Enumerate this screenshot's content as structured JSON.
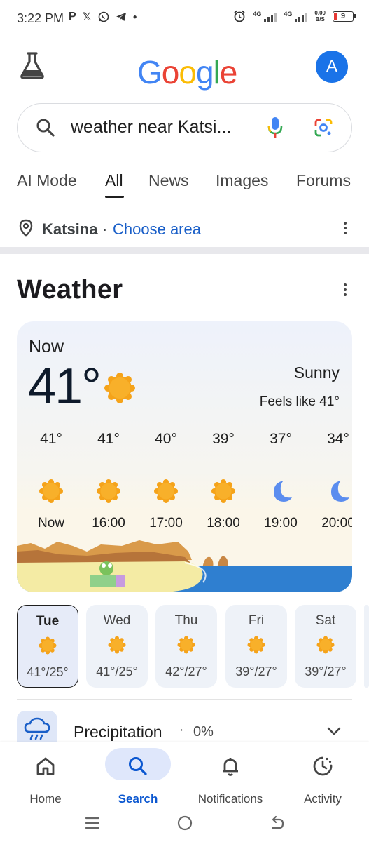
{
  "status_bar": {
    "time": "3:22 PM",
    "app_icons": [
      "P",
      "𝕏"
    ],
    "network_1": "4G",
    "network_2": "4G",
    "speed_value": "0.00",
    "speed_unit": "B/S",
    "battery": "9"
  },
  "header": {
    "logo": [
      "G",
      "o",
      "o",
      "g",
      "l",
      "e"
    ],
    "logo_colors": [
      "#4285F4",
      "#EA4335",
      "#FBBC05",
      "#4285F4",
      "#34A853",
      "#EA4335"
    ],
    "avatar_letter": "A",
    "avatar_color": "#1a73e8"
  },
  "search": {
    "query": "weather near Katsi..."
  },
  "tabs": [
    {
      "label": "AI Mode"
    },
    {
      "label": "All",
      "active": true
    },
    {
      "label": "News"
    },
    {
      "label": "Images"
    },
    {
      "label": "Forums"
    }
  ],
  "location": {
    "city": "Katsina",
    "separator": "·",
    "link": "Choose area"
  },
  "weather": {
    "title": "Weather",
    "now_label": "Now",
    "current_temp": "41°",
    "condition": "Sunny",
    "feels_like": "Feels like 41°",
    "hourly": [
      {
        "temp": "41°",
        "icon": "sun-icon",
        "time": "Now"
      },
      {
        "temp": "41°",
        "icon": "sun-icon",
        "time": "16:00"
      },
      {
        "temp": "40°",
        "icon": "sun-icon",
        "time": "17:00"
      },
      {
        "temp": "39°",
        "icon": "sun-icon",
        "time": "18:00"
      },
      {
        "temp": "37°",
        "icon": "moon-icon",
        "time": "19:00"
      },
      {
        "temp": "34°",
        "icon": "moon-icon",
        "time": "20:00"
      }
    ],
    "daily": [
      {
        "day": "Tue",
        "temps": "41°/25°",
        "selected": true
      },
      {
        "day": "Wed",
        "temps": "41°/25°"
      },
      {
        "day": "Thu",
        "temps": "42°/27°"
      },
      {
        "day": "Fri",
        "temps": "39°/27°"
      },
      {
        "day": "Sat",
        "temps": "39°/27°"
      }
    ],
    "precipitation_label": "Precipitation",
    "precipitation_dot": "·",
    "precipitation_value": "0%",
    "sun_color": "#f5a31a",
    "moon_color": "#5b8def"
  },
  "bottom_nav": [
    {
      "label": "Home",
      "icon": "home-icon"
    },
    {
      "label": "Search",
      "icon": "search-icon",
      "active": true
    },
    {
      "label": "Notifications",
      "icon": "bell-icon"
    },
    {
      "label": "Activity",
      "icon": "activity-icon"
    }
  ],
  "system_nav": [
    "recents-icon",
    "home-circle-icon",
    "back-icon"
  ]
}
